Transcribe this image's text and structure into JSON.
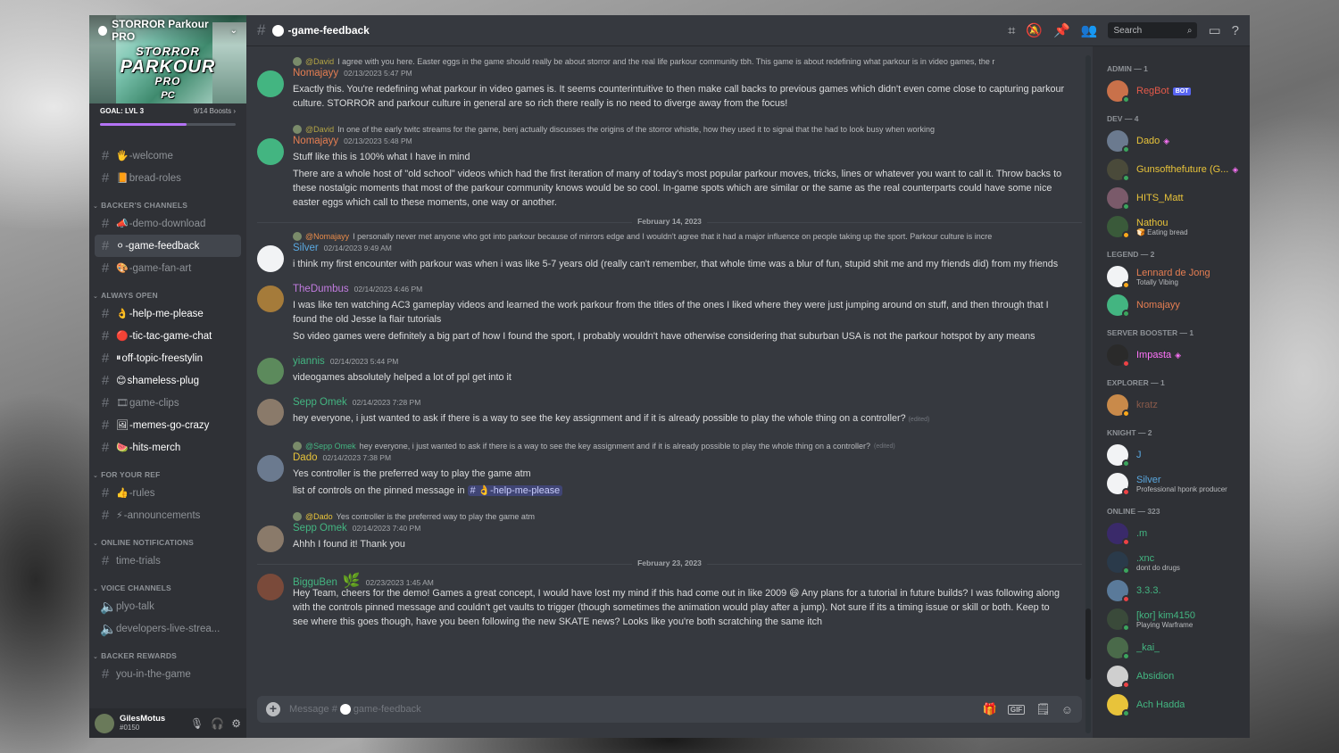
{
  "server": {
    "name": "STORROR Parkour PRO",
    "banner_logo_line1": "STORROR",
    "banner_logo_line2": "PARKOUR",
    "banner_logo_line3": "PRO",
    "banner_logo_sub": "PC",
    "boost_goal": "GOAL: LVL 3",
    "boost_count": "9/14 Boosts",
    "boost_progress": 0.64
  },
  "sidebar": {
    "top_channels": [
      {
        "icon": "🖐",
        "name": "-welcome",
        "unread": false
      },
      {
        "icon": "📙",
        "name": "bread-roles",
        "unread": false
      }
    ],
    "categories": [
      {
        "name": "BACKER'S CHANNELS",
        "channels": [
          {
            "icon": "📣",
            "name": "-demo-download",
            "unread": false,
            "active": false
          },
          {
            "icon": "⚪",
            "name": "-game-feedback",
            "unread": false,
            "active": true
          },
          {
            "icon": "🎨",
            "name": "-game-fan-art",
            "unread": false,
            "active": false
          }
        ]
      },
      {
        "name": "ALWAYS OPEN",
        "channels": [
          {
            "icon": "👌",
            "name": "-help-me-please",
            "unread": true,
            "active": false
          },
          {
            "icon": "🔴",
            "name": "-tic-tac-game-chat",
            "unread": true,
            "active": false
          },
          {
            "icon": "⏸",
            "name": "off-topic-freestylin",
            "unread": true,
            "active": false
          },
          {
            "icon": "😊",
            "name": "shameless-plug",
            "unread": true,
            "active": false
          },
          {
            "icon": "🎞",
            "name": "game-clips",
            "unread": false,
            "active": false
          },
          {
            "icon": "🖼",
            "name": "-memes-go-crazy",
            "unread": true,
            "active": false
          },
          {
            "icon": "🍉",
            "name": "-hits-merch",
            "unread": true,
            "active": false
          }
        ]
      },
      {
        "name": "FOR YOUR REF",
        "channels": [
          {
            "icon": "👍",
            "name": "-rules",
            "unread": false,
            "active": false
          },
          {
            "icon": "⚡",
            "name": "-announcements",
            "unread": false,
            "active": false
          }
        ]
      },
      {
        "name": "ONLINE NOTIFICATIONS",
        "channels": [
          {
            "icon": "",
            "name": "time-trials",
            "unread": false,
            "active": false
          }
        ]
      },
      {
        "name": "VOICE CHANNELS",
        "channels": [
          {
            "icon": "",
            "name": "plyo-talk",
            "unread": false,
            "active": false,
            "voice": true
          },
          {
            "icon": "",
            "name": "developers-live-strea...",
            "unread": false,
            "active": false,
            "voice": true
          }
        ]
      },
      {
        "name": "BACKER REWARDS",
        "channels": [
          {
            "icon": "",
            "name": "you-in-the-game",
            "unread": false,
            "active": false
          }
        ]
      }
    ]
  },
  "user": {
    "name": "GilesMotus",
    "tag": "#0150"
  },
  "header": {
    "channel": "-game-feedback",
    "search_placeholder": "Search"
  },
  "messages": [
    {
      "type": "msg",
      "reply_name": "@David",
      "reply_name_color": "#b4a545",
      "reply_text": "I agree with you here. Easter eggs in the game should really be about storror and the real life parkour community tbh. This game is about redefining what parkour is in video games, the r",
      "name": "Nomajayy",
      "name_color": "#e67e52",
      "time": "02/13/2023 5:47 PM",
      "avatar": "#43b581",
      "body": [
        "Exactly this. You're redefining what parkour in video games is. It seems counterintuitive to then make call backs to previous games which didn't even come close to capturing parkour culture. STORROR and parkour culture in general are so rich there really is no need to diverge away from the focus!"
      ]
    },
    {
      "type": "msg",
      "reply_name": "@David",
      "reply_name_color": "#b4a545",
      "reply_text": "In one of the early twitc streams for the game, benj actually discusses the origins of the storror whistle, how they used it to signal that the had to look busy when working",
      "name": "Nomajayy",
      "name_color": "#e67e52",
      "time": "02/13/2023 5:48 PM",
      "avatar": "#43b581",
      "body": [
        "Stuff like this is 100% what I have in mind",
        "There are a whole host of \"old school\" videos which had the first iteration of many of today's most popular parkour moves, tricks, lines or whatever you want to call it. Throw backs to these nostalgic moments that most of the parkour community knows would be so cool.  In-game spots which are similar or the same as the real counterparts could have some nice easter eggs which call to these moments, one way or another."
      ]
    },
    {
      "type": "divider",
      "label": "February 14, 2023"
    },
    {
      "type": "msg",
      "reply_name": "@Nomajayy",
      "reply_name_color": "#e88b4a",
      "reply_text": "I personally never met anyone who got into parkour because of mirrors edge and I wouldn't agree that it had a major influence on people taking up the sport. Parkour culture is incre",
      "name": "Silver",
      "name_color": "#5aa8e0",
      "time": "02/14/2023 9:49 AM",
      "avatar": "#f2f3f5",
      "body": [
        "i think my first encounter with parkour was when i was like 5-7 years old (really can't remember, that whole time was a blur of fun, stupid shit me and my friends did) from my friends"
      ]
    },
    {
      "type": "msg",
      "reply_name": "",
      "reply_text": "",
      "name": "TheDumbus",
      "name_color": "#c27ce0",
      "time": "02/14/2023 4:46 PM",
      "avatar": "#a57b3a",
      "body": [
        "I was like ten watching AC3 gameplay videos and learned the work parkour from the titles of the ones I liked where they were just jumping around on stuff, and then through that I found the old Jesse la flair tutorials",
        "So video games were definitely a big part of how I found the sport, I probably wouldn't have otherwise considering that suburban USA is not the parkour hotspot by any means"
      ]
    },
    {
      "type": "msg",
      "reply_name": "",
      "reply_text": "",
      "name": "yiannis",
      "name_color": "#43b581",
      "time": "02/14/2023 5:44 PM",
      "avatar": "#5c8a5c",
      "body": [
        "videogames absolutely helped a lot of ppl get into it"
      ]
    },
    {
      "type": "msg",
      "reply_name": "",
      "reply_text": "",
      "name": "Sepp Omek",
      "name_color": "#43b581",
      "time": "02/14/2023 7:28 PM",
      "avatar": "#8a7a6a",
      "body": [
        "hey everyone,  i just wanted to ask if there is a way to see the key assignment and if it is already possible to play the whole thing on a controller?"
      ],
      "edited": "(edited)"
    },
    {
      "type": "msg",
      "reply_name": "@Sepp Omek",
      "reply_name_color": "#43b581",
      "reply_text": "hey everyone, i just wanted to ask if there is a way to see the key assignment and if it is already possible to play the whole thing on a controller?",
      "reply_edited": "(edited)",
      "name": "Dado",
      "name_color": "#e8c33a",
      "time": "02/14/2023 7:38 PM",
      "avatar": "#6b7a8f",
      "body": [
        "Yes controller is the preferred way to play the game atm"
      ],
      "body2_prefix": "list of controls on the pinned message in",
      "body2_mention": "# 👌-help-me-please"
    },
    {
      "type": "msg",
      "reply_name": "@Dado",
      "reply_name_color": "#e8c33a",
      "reply_text": "Yes controller is the preferred way to play the game atm",
      "name": "Sepp Omek",
      "name_color": "#43b581",
      "time": "02/14/2023 7:40 PM",
      "avatar": "#8a7a6a",
      "body": [
        "Ahhh I found it! Thank you"
      ]
    },
    {
      "type": "divider",
      "label": "February 23, 2023"
    },
    {
      "type": "msg",
      "reply_name": "",
      "reply_text": "",
      "name": "BigguBen",
      "name_badge": "🌿",
      "name_color": "#43b581",
      "time": "02/23/2023 1:45 AM",
      "avatar": "#7a4a3a",
      "body": [
        "Hey Team, cheers for the demo! Games a great concept, I would have lost my mind if this had come out in like 2009 😄 Any plans for a tutorial in future builds? I was following along with the controls pinned message and couldn't get vaults to trigger (though sometimes the animation would play after a jump). Not sure if its a timing issue or skill or both. Keep to see where this goes though, have you been following the new SKATE news? Looks like you're both scratching the same itch"
      ]
    }
  ],
  "composer": {
    "placeholder_prefix": "Message #",
    "placeholder_channel": "game-feedback"
  },
  "members": [
    {
      "category": "ADMIN — 1",
      "items": [
        {
          "name": "RegBot",
          "color": "#e55a4a",
          "bot": "BOT",
          "status_text": "",
          "status": "online",
          "avatar": "#c9714a"
        }
      ]
    },
    {
      "category": "DEV — 4",
      "items": [
        {
          "name": "Dado",
          "color": "#e8c33a",
          "gem": true,
          "status_text": "",
          "status": "online",
          "avatar": "#6b7a8f"
        },
        {
          "name": "Gunsofthefuture (G...",
          "color": "#e8c33a",
          "gem": true,
          "status_text": "",
          "status": "online",
          "avatar": "#4a4a3a"
        },
        {
          "name": "HITS_Matt",
          "color": "#e8c33a",
          "status_text": "",
          "status": "online",
          "avatar": "#7a5a6a"
        },
        {
          "name": "Nathou",
          "color": "#e8c33a",
          "status_text": "🍞 Eating bread",
          "status": "idle",
          "avatar": "#3a5a3a"
        }
      ]
    },
    {
      "category": "LEGEND — 2",
      "items": [
        {
          "name": "Lennard de Jong",
          "color": "#e67e52",
          "status_text": "Totally Vibing",
          "status": "idle",
          "avatar": "#f2f3f5"
        },
        {
          "name": "Nomajayy",
          "color": "#e67e52",
          "status_text": "",
          "status": "online",
          "avatar": "#43b581"
        }
      ]
    },
    {
      "category": "SERVER BOOSTER — 1",
      "items": [
        {
          "name": "Impasta",
          "color": "#ff73fa",
          "gem": true,
          "status_text": "",
          "status": "dnd",
          "avatar": "#2a2a2a"
        }
      ]
    },
    {
      "category": "EXPLORER — 1",
      "items": [
        {
          "name": "kratz",
          "color": "#8a5a4a",
          "status_text": "",
          "status": "idle",
          "avatar": "#c98a4a"
        }
      ]
    },
    {
      "category": "KNIGHT — 2",
      "items": [
        {
          "name": "J",
          "color": "#5aa8e0",
          "status_text": "",
          "status": "online",
          "avatar": "#f2f3f5"
        },
        {
          "name": "Silver",
          "color": "#5aa8e0",
          "status_text": "Professional hponk producer",
          "status": "dnd",
          "avatar": "#f2f3f5"
        }
      ]
    },
    {
      "category": "ONLINE — 323",
      "items": [
        {
          "name": ".m",
          "color": "#43b581",
          "status_text": "",
          "status": "dnd",
          "avatar": "#3a2a6a"
        },
        {
          "name": ".xnc",
          "color": "#43b581",
          "status_text": "dont do drugs",
          "status": "online",
          "avatar": "#2a3a4a"
        },
        {
          "name": "3.3.3.",
          "color": "#43b581",
          "status_text": "",
          "status": "dnd",
          "avatar": "#5a7a9a"
        },
        {
          "name": "[kor] kim4150",
          "color": "#43b581",
          "status_text": "Playing Warframe",
          "status": "online",
          "avatar": "#3a4a3a"
        },
        {
          "name": "_kai_",
          "color": "#43b581",
          "status_text": "",
          "status": "online",
          "avatar": "#4a6a4a"
        },
        {
          "name": "Absidion",
          "color": "#43b581",
          "status_text": "",
          "status": "dnd",
          "avatar": "#cfcfcf"
        },
        {
          "name": "Ach Hadda",
          "color": "#43b581",
          "status_text": "",
          "status": "online",
          "avatar": "#e8c33a"
        }
      ]
    }
  ]
}
